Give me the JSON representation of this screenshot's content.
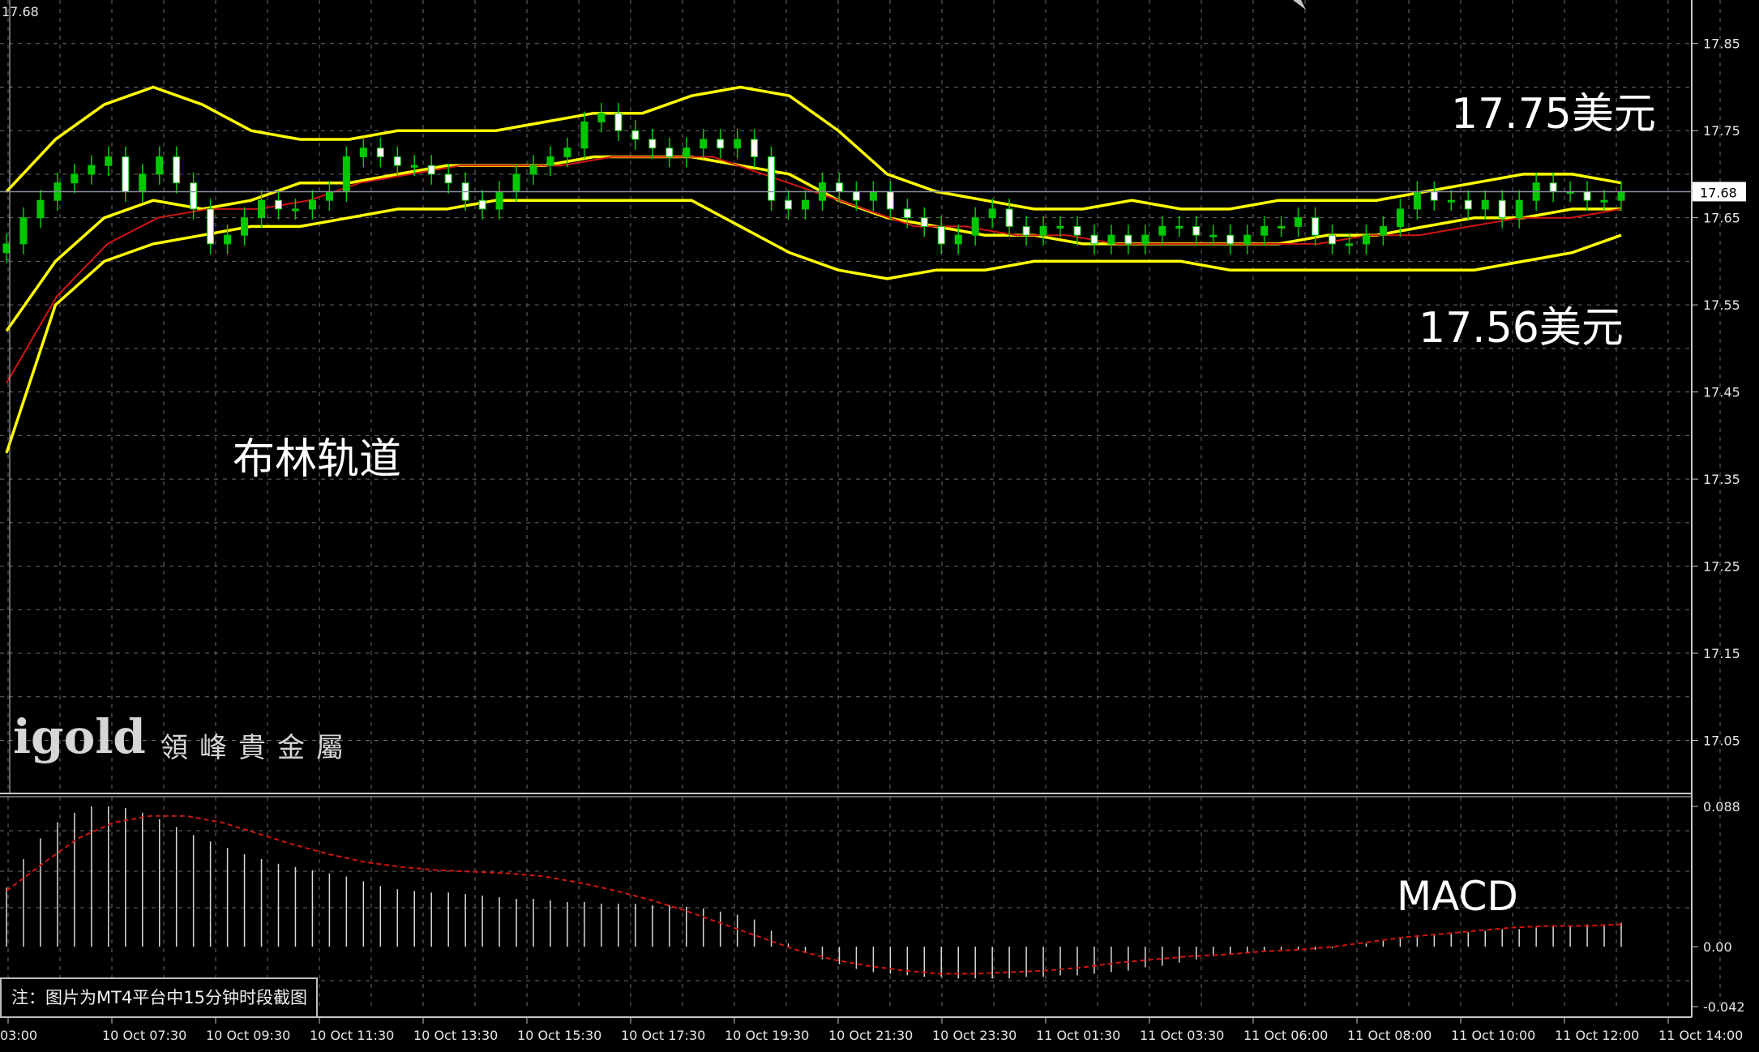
{
  "chart_data": [
    {
      "type": "candlestick",
      "title": "",
      "right_price_label": "17.68",
      "top_left_label": "17.68",
      "y_ticks": [
        "17.85",
        "17.75",
        "17.65",
        "17.55",
        "17.45",
        "17.35",
        "17.25",
        "17.15",
        "17.05"
      ],
      "ylim": [
        16.99,
        17.9
      ],
      "current_price": 17.68,
      "x_tick_labels": [
        "03:00",
        "10 Oct 07:30",
        "10 Oct 09:30",
        "10 Oct 11:30",
        "10 Oct 13:30",
        "10 Oct 15:30",
        "10 Oct 17:30",
        "10 Oct 19:30",
        "10 Oct 21:30",
        "10 Oct 23:30",
        "11 Oct 01:30",
        "11 Oct 03:30",
        "11 Oct 06:00",
        "11 Oct 08:00",
        "11 Oct 10:00",
        "11 Oct 12:00",
        "11 Oct 14:00"
      ],
      "grid": true,
      "candle_colors": {
        "up": "#00c800",
        "down": "#ffffff"
      },
      "closes": [
        17.62,
        17.65,
        17.67,
        17.69,
        17.7,
        17.71,
        17.72,
        17.68,
        17.7,
        17.72,
        17.69,
        17.66,
        17.62,
        17.63,
        17.65,
        17.67,
        17.66,
        17.66,
        17.67,
        17.68,
        17.72,
        17.73,
        17.72,
        17.71,
        17.71,
        17.7,
        17.69,
        17.67,
        17.66,
        17.68,
        17.7,
        17.71,
        17.72,
        17.73,
        17.76,
        17.77,
        17.75,
        17.74,
        17.73,
        17.72,
        17.73,
        17.74,
        17.73,
        17.74,
        17.72,
        17.67,
        17.66,
        17.67,
        17.69,
        17.68,
        17.67,
        17.68,
        17.66,
        17.65,
        17.64,
        17.62,
        17.63,
        17.65,
        17.66,
        17.64,
        17.63,
        17.64,
        17.64,
        17.63,
        17.62,
        17.63,
        17.62,
        17.63,
        17.64,
        17.64,
        17.63,
        17.63,
        17.62,
        17.63,
        17.64,
        17.64,
        17.65,
        17.63,
        17.62,
        17.62,
        17.63,
        17.64,
        17.66,
        17.68,
        17.67,
        17.67,
        17.66,
        17.67,
        17.65,
        17.67,
        17.69,
        17.68,
        17.68,
        17.67,
        17.67,
        17.68
      ],
      "upper_band": [
        17.68,
        17.74,
        17.78,
        17.8,
        17.78,
        17.75,
        17.74,
        17.74,
        17.75,
        17.75,
        17.75,
        17.76,
        17.77,
        17.77,
        17.79,
        17.8,
        17.79,
        17.75,
        17.7,
        17.68,
        17.67,
        17.66,
        17.66,
        17.67,
        17.66,
        17.66,
        17.67,
        17.67,
        17.67,
        17.68,
        17.69,
        17.7,
        17.7,
        17.69
      ],
      "middle_band": [
        17.52,
        17.6,
        17.65,
        17.67,
        17.66,
        17.67,
        17.69,
        17.69,
        17.7,
        17.71,
        17.71,
        17.71,
        17.72,
        17.72,
        17.72,
        17.71,
        17.7,
        17.67,
        17.65,
        17.64,
        17.63,
        17.63,
        17.62,
        17.62,
        17.62,
        17.62,
        17.62,
        17.63,
        17.63,
        17.64,
        17.65,
        17.65,
        17.66,
        17.66
      ],
      "lower_band": [
        17.38,
        17.55,
        17.6,
        17.62,
        17.63,
        17.64,
        17.64,
        17.65,
        17.66,
        17.66,
        17.67,
        17.67,
        17.67,
        17.67,
        17.67,
        17.64,
        17.61,
        17.59,
        17.58,
        17.59,
        17.59,
        17.6,
        17.6,
        17.6,
        17.6,
        17.59,
        17.59,
        17.59,
        17.59,
        17.59,
        17.59,
        17.6,
        17.61,
        17.63
      ],
      "ma_line": [
        17.46,
        17.56,
        17.62,
        17.65,
        17.66,
        17.66,
        17.67,
        17.69,
        17.7,
        17.71,
        17.71,
        17.71,
        17.72,
        17.72,
        17.72,
        17.7,
        17.68,
        17.66,
        17.64,
        17.64,
        17.63,
        17.63,
        17.62,
        17.62,
        17.62,
        17.62,
        17.62,
        17.63,
        17.63,
        17.64,
        17.65,
        17.65,
        17.66
      ],
      "annotations": [
        "17.75美元",
        "17.56美元",
        "布林轨道"
      ]
    },
    {
      "type": "bar",
      "title": "MACD",
      "y_ticks": [
        "0.088",
        "0.00",
        "-0.042"
      ],
      "ylim": [
        -0.042,
        0.088
      ],
      "histogram": [
        0.037,
        0.055,
        0.068,
        0.078,
        0.084,
        0.088,
        0.088,
        0.087,
        0.084,
        0.08,
        0.075,
        0.07,
        0.066,
        0.062,
        0.058,
        0.055,
        0.052,
        0.05,
        0.048,
        0.046,
        0.044,
        0.041,
        0.038,
        0.036,
        0.035,
        0.034,
        0.034,
        0.033,
        0.032,
        0.031,
        0.03,
        0.03,
        0.029,
        0.028,
        0.028,
        0.027,
        0.027,
        0.027,
        0.026,
        0.026,
        0.025,
        0.024,
        0.022,
        0.02,
        0.017,
        0.01,
        0.002,
        -0.004,
        -0.008,
        -0.011,
        -0.014,
        -0.016,
        -0.017,
        -0.018,
        -0.019,
        -0.019,
        -0.02,
        -0.02,
        -0.02,
        -0.02,
        -0.019,
        -0.019,
        -0.018,
        -0.018,
        -0.017,
        -0.016,
        -0.015,
        -0.013,
        -0.012,
        -0.01,
        -0.008,
        -0.006,
        -0.005,
        -0.004,
        -0.003,
        -0.003,
        -0.002,
        -0.002,
        -0.001,
        0.0,
        0.002,
        0.004,
        0.005,
        0.006,
        0.007,
        0.008,
        0.009,
        0.01,
        0.011,
        0.011,
        0.012,
        0.013,
        0.013,
        0.014,
        0.014,
        0.015
      ],
      "signal": [
        0.035,
        0.052,
        0.068,
        0.078,
        0.082,
        0.082,
        0.078,
        0.071,
        0.064,
        0.058,
        0.053,
        0.05,
        0.048,
        0.047,
        0.046,
        0.044,
        0.04,
        0.035,
        0.029,
        0.022,
        0.014,
        0.006,
        -0.002,
        -0.008,
        -0.012,
        -0.015,
        -0.017,
        -0.017,
        -0.016,
        -0.015,
        -0.013,
        -0.01,
        -0.008,
        -0.006,
        -0.005,
        -0.003,
        -0.002,
        0.0,
        0.003,
        0.006,
        0.008,
        0.01,
        0.012,
        0.013,
        0.013,
        0.014
      ]
    }
  ],
  "overlays": {
    "price_high": "17.75美元",
    "price_low": "17.56美元",
    "indicator_main": "布林轨道",
    "indicator_sub": "MACD"
  },
  "logo": {
    "word": "igold",
    "cn": "領峰貴金屬"
  },
  "note": "注：图片为MT4平台中15分钟时段截图",
  "colors": {
    "background": "#000000",
    "grid": "#6a6a6a",
    "band": "#ffff00",
    "ma": "#d21414",
    "macd_hist": "#d8d8d8",
    "macd_signal": "#d21414",
    "price_line": "#8a8ea0",
    "text": "#e6e6e6"
  }
}
